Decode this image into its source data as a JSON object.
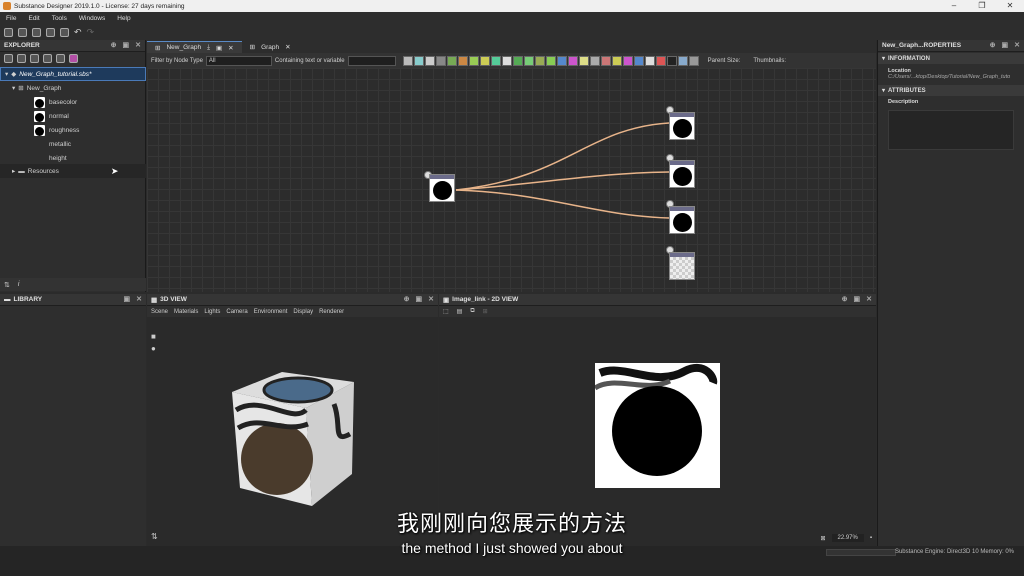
{
  "window": {
    "title": "Substance Designer 2019.1.0 - License: 27 days remaining"
  },
  "menu": [
    "File",
    "Edit",
    "Tools",
    "Windows",
    "Help"
  ],
  "explorer": {
    "title": "EXPLORER",
    "package": "New_Graph_tutorial.sbs*",
    "graph": "New_Graph",
    "outputs": [
      "basecolor",
      "normal",
      "roughness",
      "metallic",
      "height"
    ],
    "resources": "Resources"
  },
  "library": {
    "title": "LIBRARY"
  },
  "graph_tabs": [
    {
      "label": "New_Graph"
    },
    {
      "label": "Graph"
    }
  ],
  "filter": {
    "label": "Filter by Node Type",
    "value": "All",
    "text_label": "Containing text or variable",
    "parent_size": "Parent Size:",
    "thumbnails": "Thumbnails:"
  },
  "properties": {
    "title": "New_Graph...ROPERTIES",
    "info_header": "INFORMATION",
    "location_label": "Location",
    "location_value": "C:/Users/...ktop/Desktop/Tutorial/New_Graph_tuto",
    "attr_header": "ATTRIBUTES",
    "description_label": "Description"
  },
  "view3d": {
    "title": "3D VIEW",
    "menu": [
      "Scene",
      "Materials",
      "Lights",
      "Camera",
      "Environment",
      "Display",
      "Renderer"
    ]
  },
  "view2d": {
    "title": "Image_link - 2D VIEW",
    "zoom": "22.97%"
  },
  "status": {
    "engine": "Substance Engine: Direct3D 10  Memory: 0%"
  },
  "subtitle": {
    "cn": "我刚刚向您展示的方法",
    "en": "the method I just showed you about"
  }
}
